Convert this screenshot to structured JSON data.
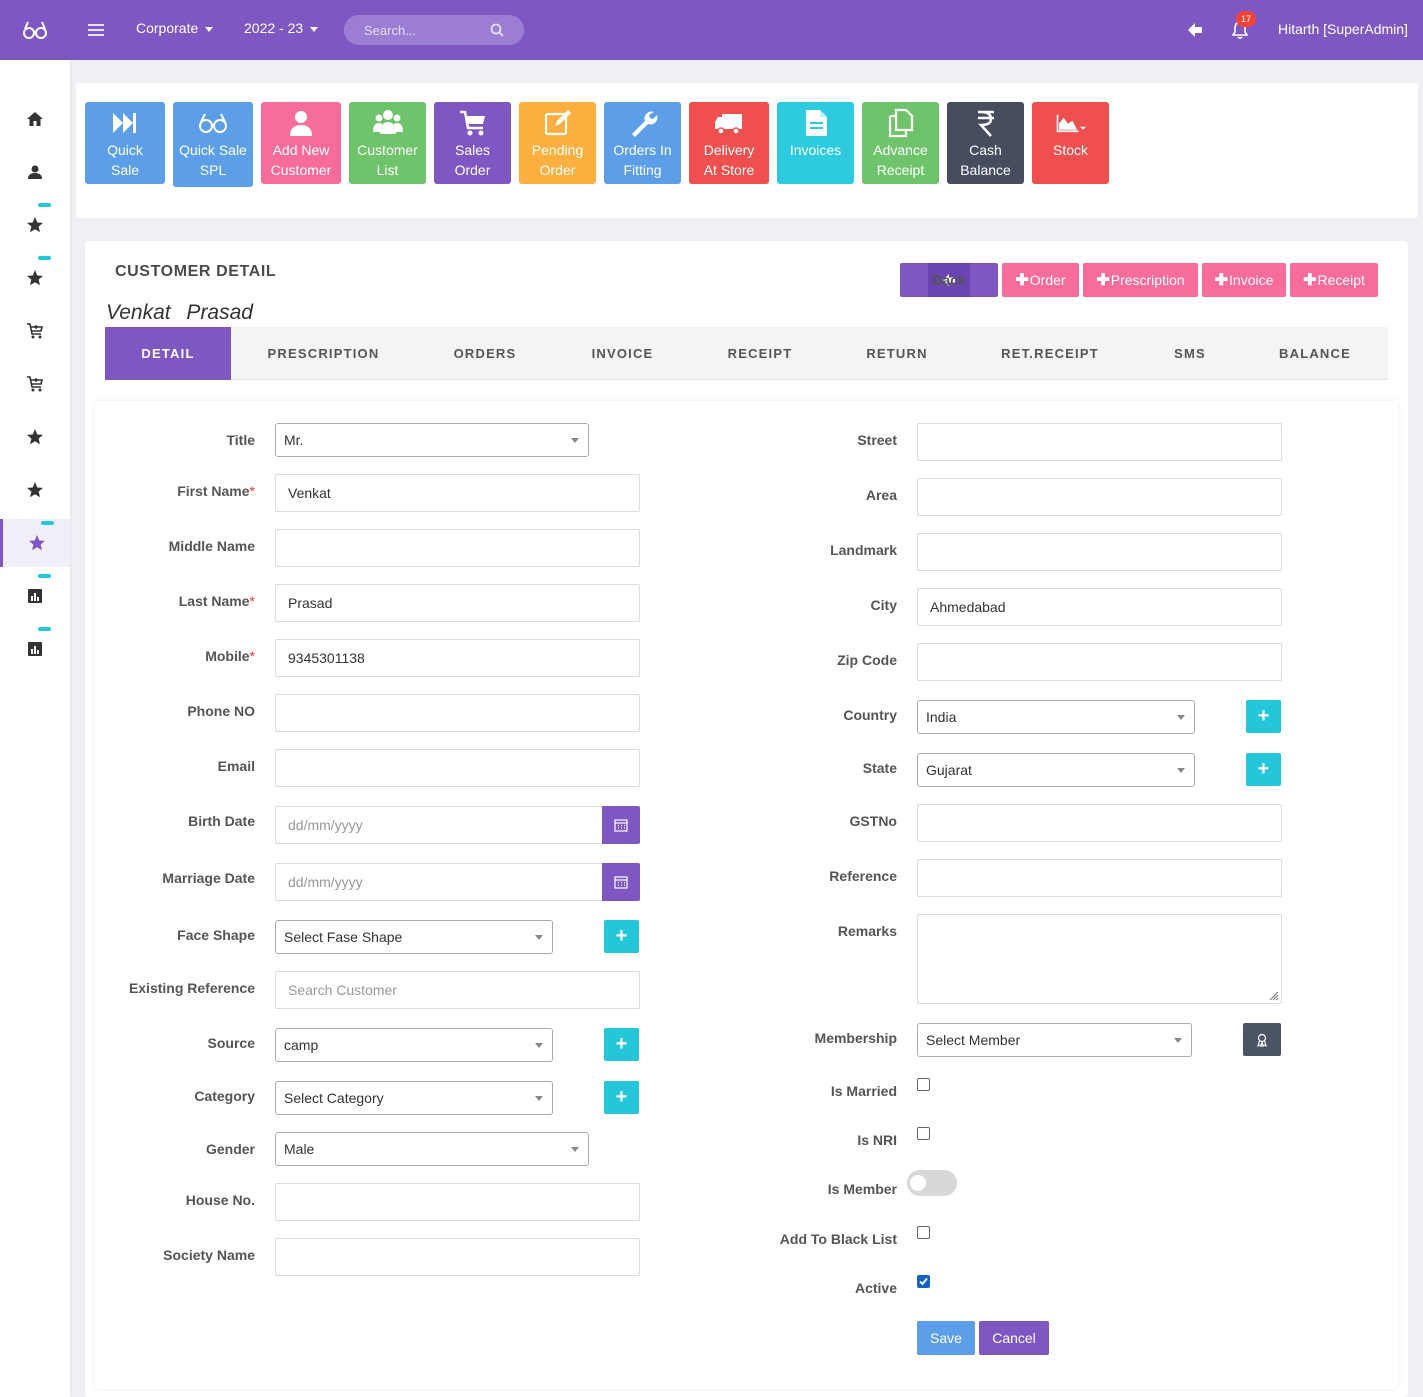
{
  "topbar": {
    "company": "Corporate",
    "year": "2022 - 23",
    "search_placeholder": "Search...",
    "notification_count": "17",
    "user": "Hitarth [SuperAdmin]"
  },
  "sidebar": {
    "items": [
      "home-icon",
      "user-icon",
      "star-icon",
      "star-icon",
      "cart-icon",
      "cart-icon",
      "star-icon",
      "star-icon",
      "star-icon",
      "chart-icon",
      "chart-icon"
    ]
  },
  "quick_actions": [
    {
      "line1": "Quick",
      "line2": "Sale",
      "color": "#5c9ee8",
      "icon": "fast-forward-icon"
    },
    {
      "line1": "Quick Sale",
      "line2": "SPL",
      "color": "#5c9ee8",
      "icon": "glasses-icon"
    },
    {
      "line1": "Add New",
      "line2": "Customer",
      "color": "#f76c9b",
      "icon": "user-icon"
    },
    {
      "line1": "Customer",
      "line2": "List",
      "color": "#6fc36a",
      "icon": "users-icon"
    },
    {
      "line1": "Sales",
      "line2": "Order",
      "color": "#7e57c2",
      "icon": "cart-icon"
    },
    {
      "line1": "Pending",
      "line2": "Order",
      "color": "#fdb040",
      "icon": "edit-icon"
    },
    {
      "line1": "Orders In",
      "line2": "Fitting",
      "color": "#5c9ee8",
      "icon": "wrench-icon"
    },
    {
      "line1": "Delivery",
      "line2": "At Store",
      "color": "#ef4f4f",
      "icon": "truck-icon"
    },
    {
      "line1": "Invoices",
      "line2": "",
      "color": "#2ecbe0",
      "icon": "document-icon"
    },
    {
      "line1": "Advance",
      "line2": "Receipt",
      "color": "#6fc36a",
      "icon": "copy-icon"
    },
    {
      "line1": "Cash",
      "line2": "Balance",
      "color": "#454d5e",
      "icon": "rupee-icon"
    },
    {
      "line1": "Stock",
      "line2": "",
      "color": "#ef4f4f",
      "icon": "area-chart-icon"
    }
  ],
  "card": {
    "title": "CUSTOMER DETAIL",
    "customer_name": "Venkat Prasad",
    "buttons": {
      "back": "Back",
      "order": "Order",
      "prescription": "Prescription",
      "invoice": "Invoice",
      "receipt": "Receipt"
    },
    "tabs": [
      "DETAIL",
      "PRESCRIPTION",
      "ORDERS",
      "INVOICE",
      "RECEIPT",
      "RETURN",
      "RET.RECEIPT",
      "SMS",
      "BALANCE"
    ]
  },
  "form": {
    "left": {
      "title": {
        "label": "Title",
        "value": "Mr."
      },
      "first_name": {
        "label": "First Name",
        "value": "Venkat"
      },
      "middle_name": {
        "label": "Middle Name",
        "value": ""
      },
      "last_name": {
        "label": "Last Name",
        "value": "Prasad"
      },
      "mobile": {
        "label": "Mobile",
        "value": "9345301138"
      },
      "phone": {
        "label": "Phone NO",
        "value": ""
      },
      "email": {
        "label": "Email",
        "value": ""
      },
      "birth_date": {
        "label": "Birth Date",
        "placeholder": "dd/mm/yyyy"
      },
      "marriage_date": {
        "label": "Marriage Date",
        "placeholder": "dd/mm/yyyy"
      },
      "face_shape": {
        "label": "Face Shape",
        "value": "Select Fase Shape"
      },
      "existing_reference": {
        "label": "Existing Reference",
        "placeholder": "Search Customer"
      },
      "source": {
        "label": "Source",
        "value": "camp"
      },
      "category": {
        "label": "Category",
        "value": "Select Category"
      },
      "gender": {
        "label": "Gender",
        "value": "Male"
      },
      "house_no": {
        "label": "House No.",
        "value": ""
      },
      "society_name": {
        "label": "Society Name",
        "value": ""
      }
    },
    "right": {
      "street": {
        "label": "Street",
        "value": ""
      },
      "area": {
        "label": "Area",
        "value": ""
      },
      "landmark": {
        "label": "Landmark",
        "value": ""
      },
      "city": {
        "label": "City",
        "value": "Ahmedabad"
      },
      "zip_code": {
        "label": "Zip Code",
        "value": ""
      },
      "country": {
        "label": "Country",
        "value": "India"
      },
      "state": {
        "label": "State",
        "value": "Gujarat"
      },
      "gstno": {
        "label": "GSTNo",
        "value": ""
      },
      "reference": {
        "label": "Reference",
        "value": ""
      },
      "remarks": {
        "label": "Remarks",
        "value": ""
      },
      "membership": {
        "label": "Membership",
        "value": "Select Member"
      },
      "is_married": {
        "label": "Is Married",
        "checked": false
      },
      "is_nri": {
        "label": "Is NRI",
        "checked": false
      },
      "is_member": {
        "label": "Is Member",
        "on": false
      },
      "black_list": {
        "label": "Add To Black List",
        "checked": false
      },
      "active": {
        "label": "Active",
        "checked": true
      }
    },
    "save": "Save",
    "cancel": "Cancel"
  },
  "colors": {
    "primary": "#7e57c2",
    "accent": "#26c6da",
    "pink": "#f76c9b",
    "save_blue": "#5c9ee8",
    "required": "#e53935"
  }
}
